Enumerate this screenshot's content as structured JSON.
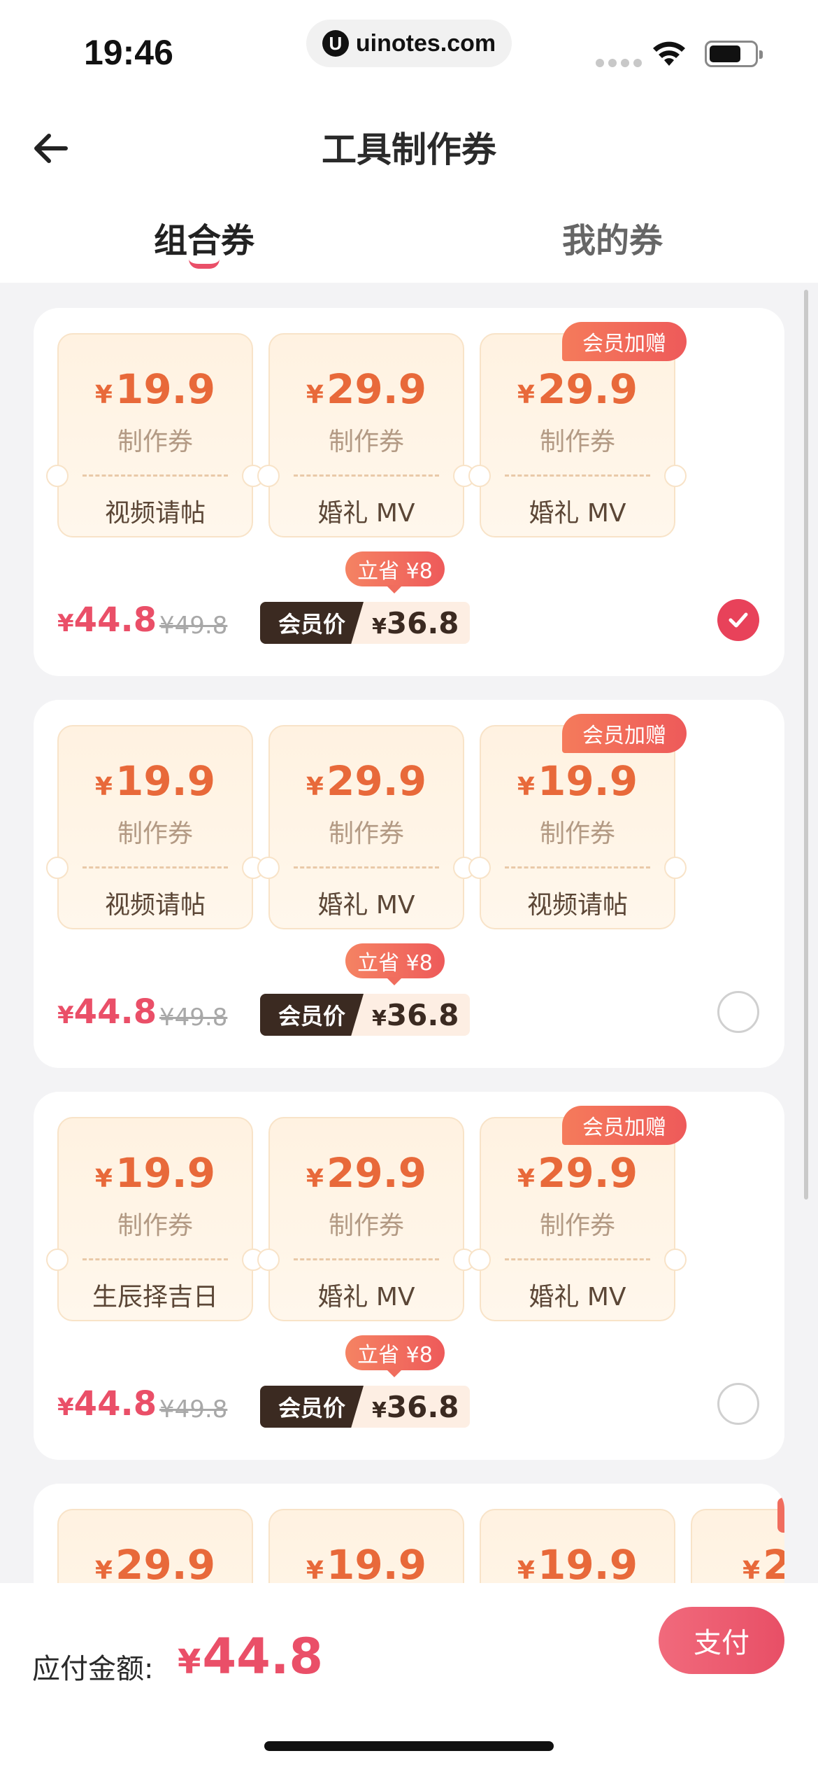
{
  "status_bar": {
    "time": "19:46",
    "url_icon": "U",
    "url": "uinotes.com"
  },
  "header": {
    "title": "工具制作券"
  },
  "tabs": {
    "combo": "组合券",
    "mine": "我的券"
  },
  "bundles": [
    {
      "coupons": [
        {
          "yen": "¥",
          "price": "19.9",
          "type": "制作券",
          "name": "视频请帖"
        },
        {
          "yen": "¥",
          "price": "29.9",
          "type": "制作券",
          "name": "婚礼 MV"
        },
        {
          "yen": "¥",
          "price": "29.9",
          "type": "制作券",
          "name": "婚礼 MV"
        }
      ],
      "gift_badge": "会员加赠",
      "save_badge": "立省 ¥8",
      "price": "44.8",
      "yen": "¥",
      "original_price": "¥49.8",
      "member_label": "会员价",
      "member_price": "36.8",
      "selected": true
    },
    {
      "coupons": [
        {
          "yen": "¥",
          "price": "19.9",
          "type": "制作券",
          "name": "视频请帖"
        },
        {
          "yen": "¥",
          "price": "29.9",
          "type": "制作券",
          "name": "婚礼 MV"
        },
        {
          "yen": "¥",
          "price": "19.9",
          "type": "制作券",
          "name": "视频请帖"
        }
      ],
      "gift_badge": "会员加赠",
      "save_badge": "立省 ¥8",
      "price": "44.8",
      "yen": "¥",
      "original_price": "¥49.8",
      "member_label": "会员价",
      "member_price": "36.8",
      "selected": false
    },
    {
      "coupons": [
        {
          "yen": "¥",
          "price": "19.9",
          "type": "制作券",
          "name": "生辰择吉日"
        },
        {
          "yen": "¥",
          "price": "29.9",
          "type": "制作券",
          "name": "婚礼 MV"
        },
        {
          "yen": "¥",
          "price": "29.9",
          "type": "制作券",
          "name": "婚礼 MV"
        }
      ],
      "gift_badge": "会员加赠",
      "save_badge": "立省 ¥8",
      "price": "44.8",
      "yen": "¥",
      "original_price": "¥49.8",
      "member_label": "会员价",
      "member_price": "36.8",
      "selected": false
    },
    {
      "coupons": [
        {
          "yen": "¥",
          "price": "29.9"
        },
        {
          "yen": "¥",
          "price": "19.9"
        },
        {
          "yen": "¥",
          "price": "19.9"
        },
        {
          "yen": "¥",
          "price": "2"
        }
      ]
    }
  ],
  "footer": {
    "payable_label": "应付金额:",
    "yen": "¥",
    "payable_amount": "44.8",
    "pay_button": "支付"
  },
  "colors": {
    "accent": "#ea4f68",
    "coupon_price": "#e8693a",
    "member_dark": "#3b2a21"
  }
}
